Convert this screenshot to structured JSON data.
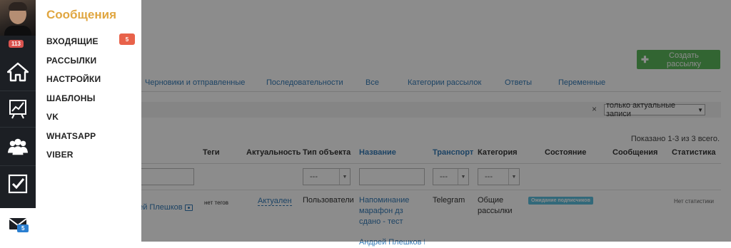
{
  "menu": {
    "title": "Сообщения",
    "items": [
      {
        "label": "ВХОДЯЩИЕ",
        "badge": "5"
      },
      {
        "label": "РАССЫЛКИ"
      },
      {
        "label": "НАСТРОЙКИ"
      },
      {
        "label": "ШАБЛОНЫ"
      },
      {
        "label": "VK"
      },
      {
        "label": "WHATSAPP"
      },
      {
        "label": "VIBER"
      }
    ]
  },
  "rail": {
    "notifications_count": "113",
    "icons": [
      "home-icon",
      "chart-icon",
      "users-icon",
      "tasks-icon",
      "mail-icon"
    ],
    "mail_badge": "5"
  },
  "page": {
    "create_button": "Создать рассылку",
    "tabs": [
      "Черновики и отправленные",
      "Последовательности",
      "Все",
      "Категории рассылок",
      "Ответы",
      "Переменные"
    ],
    "filter": {
      "clear": "×",
      "select_value": "только актуальные записи"
    },
    "showing_text": "Показано 1-3 из 3 всего.",
    "table": {
      "headers": [
        "Теги",
        "Актуальность",
        "Тип объекта",
        "Название",
        "Транспорт",
        "Категория",
        "Состояние",
        "Сообщения",
        "Статистика"
      ],
      "filter_select_value": "---",
      "row": {
        "author": "рей Плешков",
        "tags": "нет тегов",
        "relevance": "Актуален",
        "object_type": "Пользователи",
        "name": "Напоминание марафон дз сдано - тест",
        "name_next": "Андрей Плешков Пл",
        "transport": "Telegram",
        "category": "Общие рассылки",
        "state": "Ожидание подписчиков",
        "statistics": "Нет статистики"
      }
    }
  },
  "colors": {
    "menu_title": "#e0a640",
    "badge_red": "#e8624a",
    "create_button": "#5cb85c",
    "link": "#337ab7",
    "rail_bg": "#1c1f24",
    "state_badge": "#5bc0de"
  }
}
